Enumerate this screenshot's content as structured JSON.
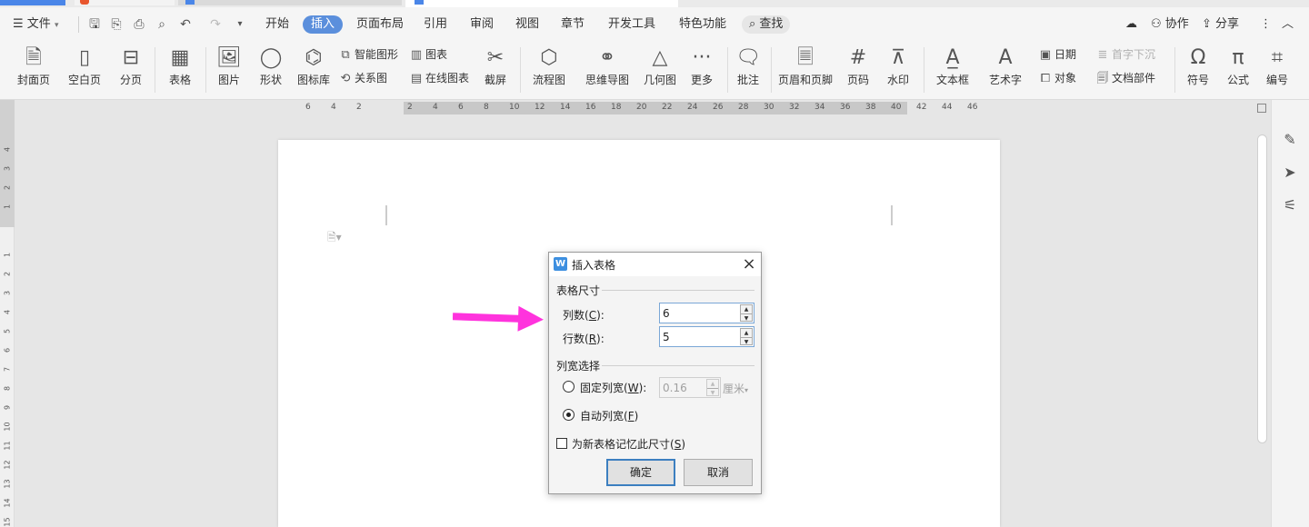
{
  "menu": {
    "file": "文件",
    "tabs": [
      "开始",
      "插入",
      "页面布局",
      "引用",
      "审阅",
      "视图",
      "章节",
      "开发工具",
      "特色功能"
    ],
    "active_tab": "插入",
    "search": "查找",
    "collab": "协作",
    "share": "分享"
  },
  "ribbon": {
    "cover": "封面页",
    "blank": "空白页",
    "pagebreak": "分页",
    "table": "表格",
    "picture": "图片",
    "shape": "形状",
    "iconlib": "图标库",
    "smartart": "智能图形",
    "chart": "图表",
    "relation": "关系图",
    "online_chart": "在线图表",
    "screenshot": "截屏",
    "flowchart": "流程图",
    "mindmap": "思维导图",
    "geometry": "几何图",
    "more": "更多",
    "comment": "批注",
    "header_footer": "页眉和页脚",
    "page_num": "页码",
    "watermark": "水印",
    "textbox": "文本框",
    "wordart": "艺术字",
    "date": "日期",
    "object": "对象",
    "dropcap": "首字下沉",
    "docpart": "文档部件",
    "symbol": "符号",
    "formula": "公式",
    "numbering": "编号"
  },
  "ruler": {
    "top": [
      "6",
      "4",
      "2",
      "2",
      "4",
      "6",
      "8",
      "10",
      "12",
      "14",
      "16",
      "18",
      "20",
      "22",
      "24",
      "26",
      "28",
      "30",
      "32",
      "34",
      "36",
      "38",
      "40",
      "42",
      "44",
      "46"
    ],
    "left": [
      "4",
      "3",
      "2",
      "1",
      "1",
      "2",
      "3",
      "4",
      "5",
      "6",
      "7",
      "8",
      "9",
      "10",
      "11",
      "12",
      "13",
      "14",
      "15"
    ]
  },
  "dialog": {
    "title": "插入表格",
    "size_group": "表格尺寸",
    "cols_label": "列数(",
    "cols_key": "C",
    "cols_value": "6",
    "rows_label": "行数(",
    "rows_key": "R",
    "rows_value": "5",
    "width_group": "列宽选择",
    "fixed_label": "固定列宽(",
    "fixed_key": "W",
    "fixed_value": "0.16",
    "unit": "厘米",
    "auto_label": "自动列宽(",
    "auto_key": "F",
    "remember_label": "为新表格记忆此尺寸(",
    "remember_key": "S",
    "ok": "确定",
    "cancel": "取消"
  },
  "colors": {
    "accent": "#5b8fdc",
    "arrow": "#ff33dd",
    "wps_logo": "#3d8fe0"
  }
}
